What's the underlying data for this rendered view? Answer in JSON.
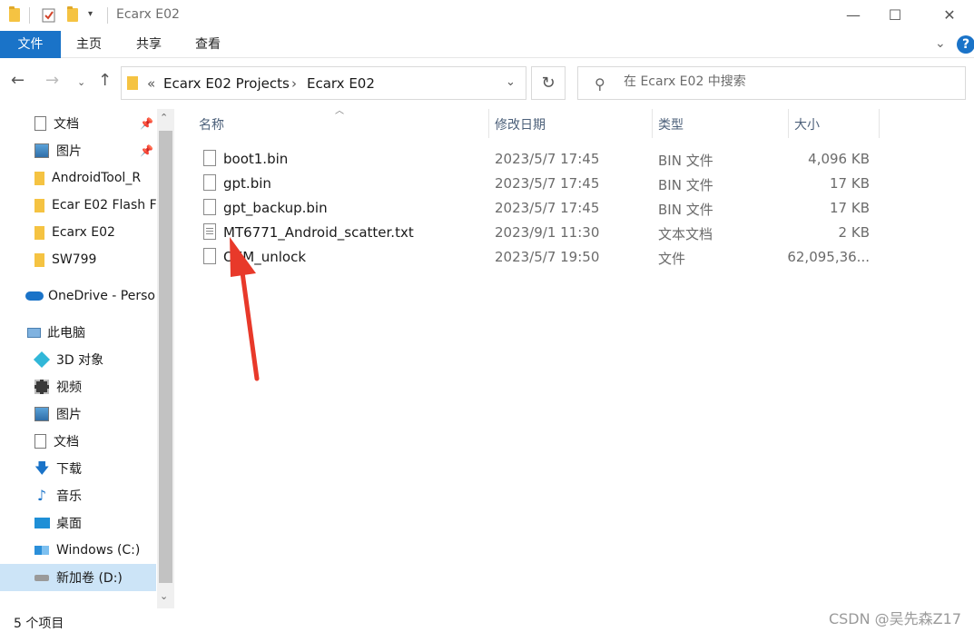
{
  "window": {
    "title": "Ecarx E02",
    "minimize_glyph": "—",
    "maximize_glyph": "☐",
    "close_glyph": "✕"
  },
  "ribbon": {
    "tabs": [
      "文件",
      "主页",
      "共享",
      "查看"
    ],
    "help_glyph": "?"
  },
  "address": {
    "overflow": "«",
    "parts": [
      "Ecarx E02 Projects",
      "Ecarx E02"
    ]
  },
  "search": {
    "placeholder": "在 Ecarx E02 中搜索"
  },
  "sidebar": {
    "items": [
      {
        "label": "文档",
        "icon": "document-icon",
        "pinned": true
      },
      {
        "label": "图片",
        "icon": "picture-icon",
        "pinned": true
      },
      {
        "label": "AndroidTool_R",
        "icon": "folder-icon"
      },
      {
        "label": "Ecar E02 Flash F",
        "icon": "folder-icon"
      },
      {
        "label": "Ecarx E02",
        "icon": "folder-icon"
      },
      {
        "label": "SW799",
        "icon": "folder-icon"
      },
      {
        "label": "OneDrive - Perso",
        "icon": "cloud-icon"
      },
      {
        "label": "此电脑",
        "icon": "computer-icon"
      },
      {
        "label": "3D 对象",
        "icon": "cube-icon"
      },
      {
        "label": "视频",
        "icon": "video-icon"
      },
      {
        "label": "图片",
        "icon": "picture-icon"
      },
      {
        "label": "文档",
        "icon": "document-icon"
      },
      {
        "label": "下载",
        "icon": "download-icon"
      },
      {
        "label": "音乐",
        "icon": "music-icon"
      },
      {
        "label": "桌面",
        "icon": "desktop-icon"
      },
      {
        "label": "Windows (C:)",
        "icon": "drive-c-icon"
      },
      {
        "label": "新加卷 (D:)",
        "icon": "drive-d-icon",
        "selected": true
      }
    ]
  },
  "columns": [
    "名称",
    "修改日期",
    "类型",
    "大小"
  ],
  "files": [
    {
      "name": "boot1.bin",
      "date": "2023/5/7 17:45",
      "type": "BIN 文件",
      "size": "4,096 KB",
      "icon": "file-icon"
    },
    {
      "name": "gpt.bin",
      "date": "2023/5/7 17:45",
      "type": "BIN 文件",
      "size": "17 KB",
      "icon": "file-icon"
    },
    {
      "name": "gpt_backup.bin",
      "date": "2023/5/7 17:45",
      "type": "BIN 文件",
      "size": "17 KB",
      "icon": "file-icon"
    },
    {
      "name": "MT6771_Android_scatter.txt",
      "date": "2023/9/1 11:30",
      "type": "文本文档",
      "size": "2 KB",
      "icon": "text-file-icon"
    },
    {
      "name": "OEM_unlock",
      "date": "2023/5/7 19:50",
      "type": "文件",
      "size": "62,095,36...",
      "icon": "file-icon"
    }
  ],
  "status": {
    "count": "5 个项目"
  },
  "watermark": "CSDN @吴先森Z17",
  "colors": {
    "accent": "#1a73c8",
    "annotation_arrow": "#e8392a",
    "selected_bg": "#cce4f7"
  }
}
